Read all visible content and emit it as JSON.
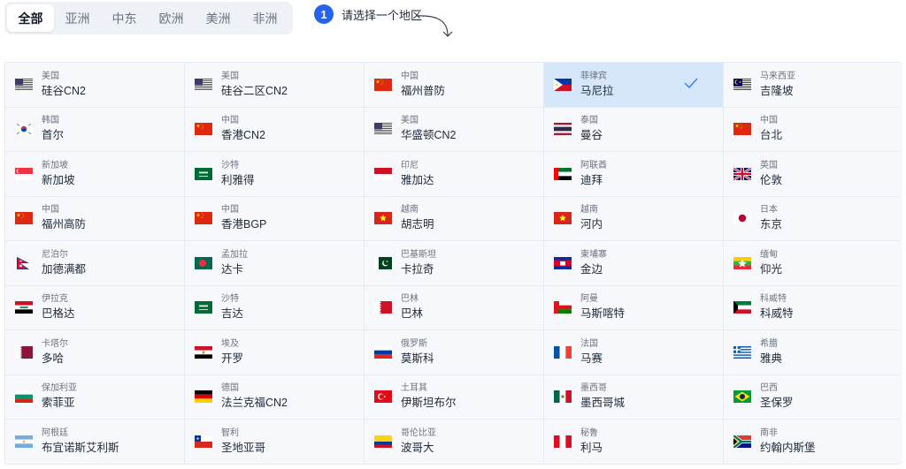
{
  "tabs": [
    {
      "label": "全部",
      "active": true
    },
    {
      "label": "亚洲",
      "active": false
    },
    {
      "label": "中东",
      "active": false
    },
    {
      "label": "欧洲",
      "active": false
    },
    {
      "label": "美洲",
      "active": false
    },
    {
      "label": "非洲",
      "active": false
    }
  ],
  "step": {
    "number": "1",
    "text": "请选择一个地区"
  },
  "regions": [
    {
      "country": "美国",
      "city": "硅谷CN2",
      "flag": "us"
    },
    {
      "country": "美国",
      "city": "硅谷二区CN2",
      "flag": "us"
    },
    {
      "country": "中国",
      "city": "福州普防",
      "flag": "cn"
    },
    {
      "country": "菲律宾",
      "city": "马尼拉",
      "flag": "ph",
      "selected": true
    },
    {
      "country": "马来西亚",
      "city": "吉隆坡",
      "flag": "my"
    },
    {
      "country": "韩国",
      "city": "首尔",
      "flag": "kr"
    },
    {
      "country": "中国",
      "city": "香港CN2",
      "flag": "cn"
    },
    {
      "country": "美国",
      "city": "华盛顿CN2",
      "flag": "us"
    },
    {
      "country": "泰国",
      "city": "曼谷",
      "flag": "th"
    },
    {
      "country": "中国",
      "city": "台北",
      "flag": "cn"
    },
    {
      "country": "新加坡",
      "city": "新加坡",
      "flag": "sg"
    },
    {
      "country": "沙特",
      "city": "利雅得",
      "flag": "sa"
    },
    {
      "country": "印尼",
      "city": "雅加达",
      "flag": "id"
    },
    {
      "country": "阿联酋",
      "city": "迪拜",
      "flag": "ae"
    },
    {
      "country": "英国",
      "city": "伦敦",
      "flag": "gb"
    },
    {
      "country": "中国",
      "city": "福州高防",
      "flag": "cn"
    },
    {
      "country": "中国",
      "city": "香港BGP",
      "flag": "cn"
    },
    {
      "country": "越南",
      "city": "胡志明",
      "flag": "vn"
    },
    {
      "country": "越南",
      "city": "河内",
      "flag": "vn"
    },
    {
      "country": "日本",
      "city": "东京",
      "flag": "jp"
    },
    {
      "country": "尼泊尔",
      "city": "加德满都",
      "flag": "np"
    },
    {
      "country": "孟加拉",
      "city": "达卡",
      "flag": "bd"
    },
    {
      "country": "巴基斯坦",
      "city": "卡拉奇",
      "flag": "pk"
    },
    {
      "country": "柬埔寨",
      "city": "金边",
      "flag": "kh"
    },
    {
      "country": "缅甸",
      "city": "仰光",
      "flag": "mm"
    },
    {
      "country": "伊拉克",
      "city": "巴格达",
      "flag": "iq"
    },
    {
      "country": "沙特",
      "city": "吉达",
      "flag": "sa"
    },
    {
      "country": "巴林",
      "city": "巴林",
      "flag": "bh"
    },
    {
      "country": "阿曼",
      "city": "马斯喀特",
      "flag": "om"
    },
    {
      "country": "科威特",
      "city": "科威特",
      "flag": "kw"
    },
    {
      "country": "卡塔尔",
      "city": "多哈",
      "flag": "qa"
    },
    {
      "country": "埃及",
      "city": "开罗",
      "flag": "eg"
    },
    {
      "country": "俄罗斯",
      "city": "莫斯科",
      "flag": "ru"
    },
    {
      "country": "法国",
      "city": "马赛",
      "flag": "fr"
    },
    {
      "country": "希腊",
      "city": "雅典",
      "flag": "gr"
    },
    {
      "country": "保加利亚",
      "city": "索菲亚",
      "flag": "bg"
    },
    {
      "country": "德国",
      "city": "法兰克福CN2",
      "flag": "de"
    },
    {
      "country": "土耳其",
      "city": "伊斯坦布尔",
      "flag": "tr"
    },
    {
      "country": "墨西哥",
      "city": "墨西哥城",
      "flag": "mx"
    },
    {
      "country": "巴西",
      "city": "圣保罗",
      "flag": "br"
    },
    {
      "country": "阿根廷",
      "city": "布宜诺斯艾利斯",
      "flag": "ar"
    },
    {
      "country": "智利",
      "city": "圣地亚哥",
      "flag": "cl"
    },
    {
      "country": "哥伦比亚",
      "city": "波哥大",
      "flag": "co"
    },
    {
      "country": "秘鲁",
      "city": "利马",
      "flag": "pe"
    },
    {
      "country": "南非",
      "city": "约翰内斯堡",
      "flag": "za"
    }
  ]
}
